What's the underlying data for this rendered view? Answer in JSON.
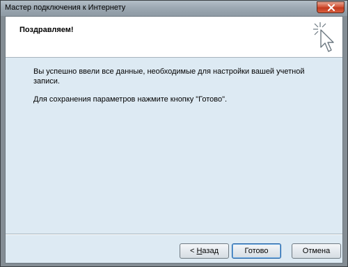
{
  "window": {
    "title": "Мастер подключения к Интернету"
  },
  "header": {
    "title": "Поздравляем!"
  },
  "content": {
    "line1": "Вы успешно ввели все данные, необходимые для настройки вашей учетной",
    "line2": "записи.",
    "line3": "Для сохранения параметров нажмите кнопку \"Готово\"."
  },
  "buttons": {
    "back_prefix": "< ",
    "back_accel": "Н",
    "back_rest": "азад",
    "finish": "Готово",
    "cancel": "Отмена"
  },
  "icons": {
    "close": "close-icon",
    "wizard": "wizard-cursor-icon"
  },
  "colors": {
    "client_bg": "#ddeaf3",
    "close_button": "#c23a1f",
    "default_button_border": "#1e5fa3"
  }
}
